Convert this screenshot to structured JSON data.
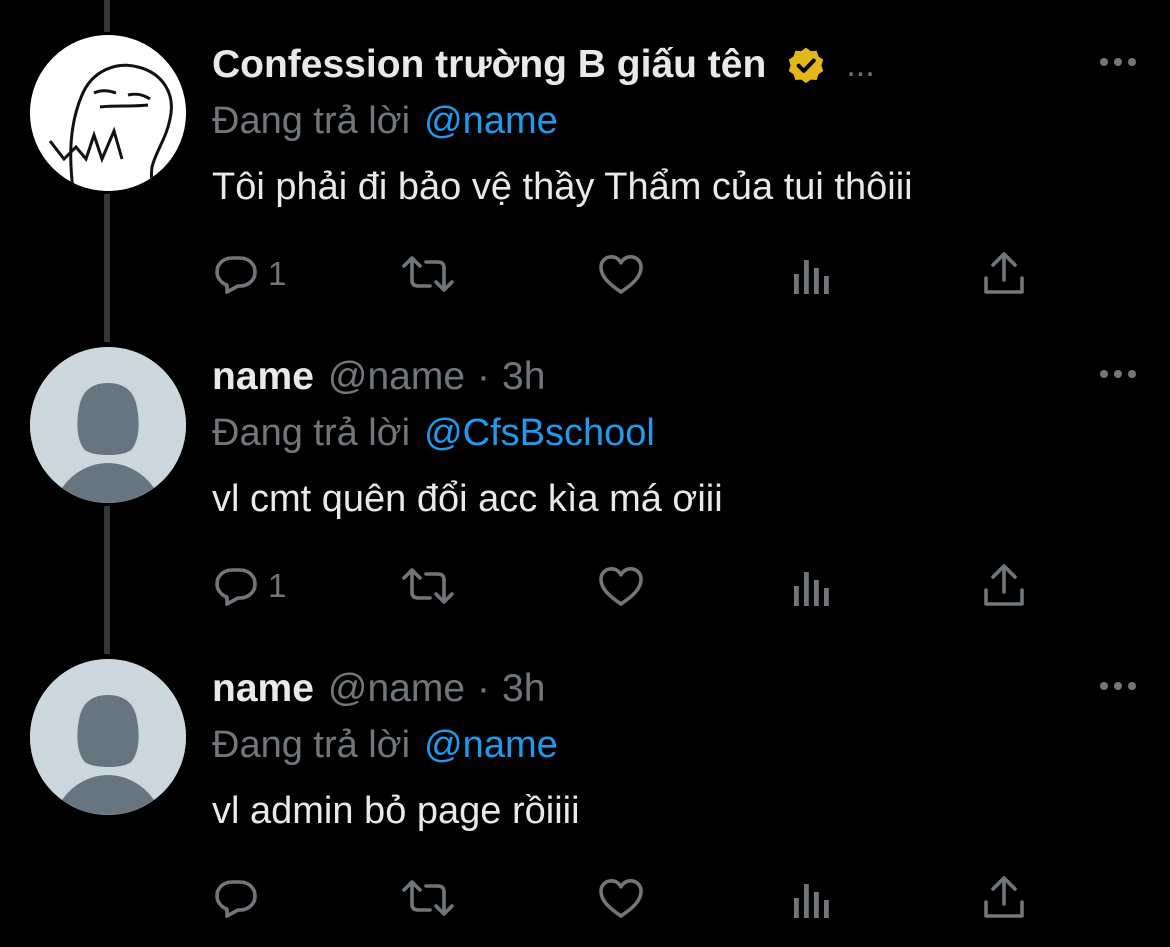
{
  "colors": {
    "background": "#000000",
    "text": "#e7e9ea",
    "muted": "#71767b",
    "link": "#1d9bf0",
    "verified_badge": "#e2b719",
    "thread_line": "#333639"
  },
  "tweets": [
    {
      "display_name": "Confession trường B giấu tên",
      "verified": true,
      "header_suffix": "...",
      "reply_prefix": "Đang trả lời",
      "reply_to": "@name",
      "text": "Tôi phải đi bảo vệ thầy Thẩm của tui thôiii",
      "reply_count": "1",
      "avatar_icon": "drawn-face-avatar-icon"
    },
    {
      "display_name": "name",
      "handle": "@name",
      "separator": "·",
      "time": "3h",
      "reply_prefix": "Đang trả lời",
      "reply_to": "@CfsBschool",
      "text": "vl cmt quên đổi acc kìa má ơiii",
      "reply_count": "1",
      "avatar_icon": "default-profile-avatar-icon"
    },
    {
      "display_name": "name",
      "handle": "@name",
      "separator": "·",
      "time": "3h",
      "reply_prefix": "Đang trả lời",
      "reply_to": "@name",
      "text": "vl admin bỏ page rồiiii",
      "reply_count": "",
      "avatar_icon": "default-profile-avatar-icon"
    }
  ],
  "action_icons": [
    "reply-icon",
    "retweet-icon",
    "like-icon",
    "analytics-icon",
    "share-icon"
  ],
  "more_icon": "more-options-icon"
}
